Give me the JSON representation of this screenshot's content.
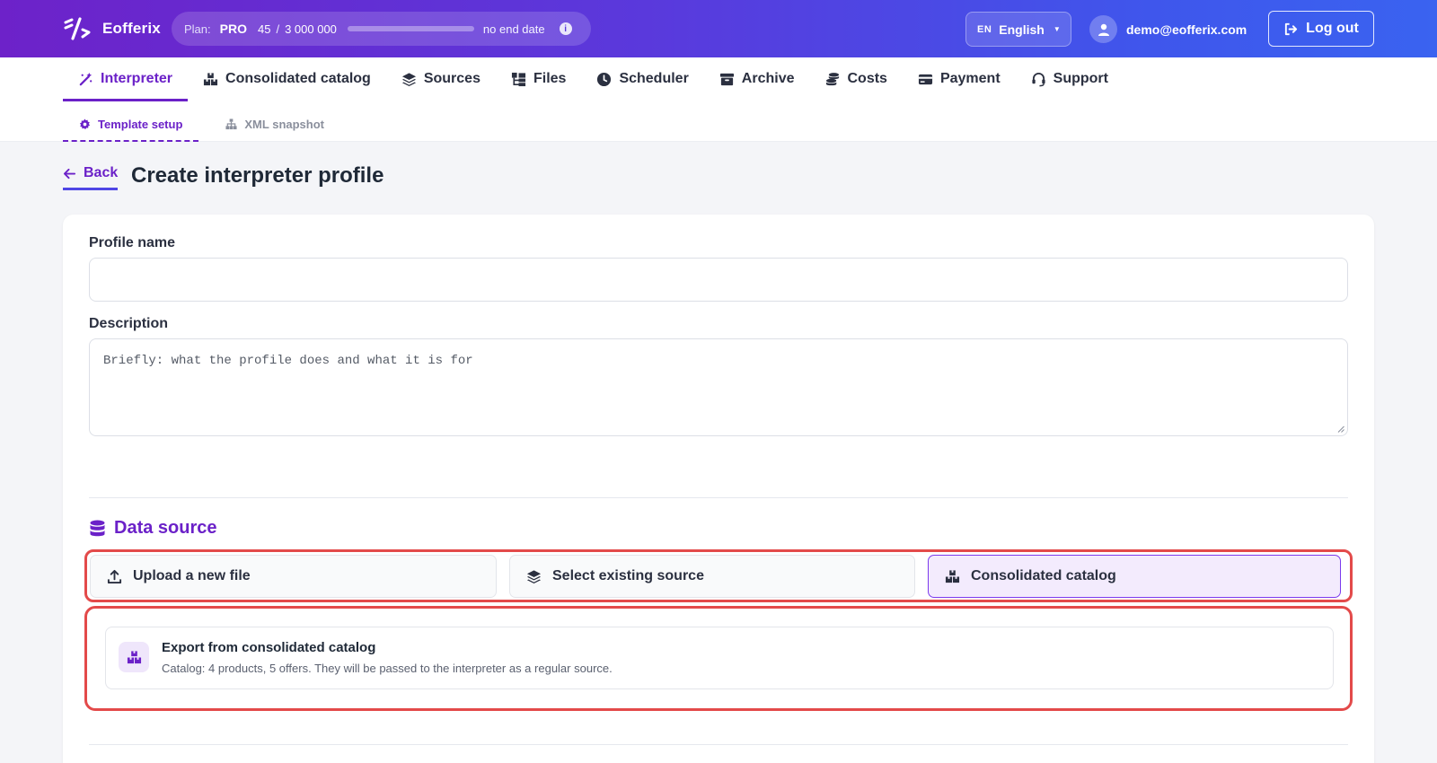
{
  "app": {
    "name": "Eofferix"
  },
  "plan": {
    "label": "Plan:",
    "tier": "PRO",
    "used": "45",
    "separator": "/",
    "limit": "3 000 000",
    "usage_fraction": 1.5e-05,
    "end_date": "no end date"
  },
  "language": {
    "code": "EN",
    "name": "English"
  },
  "user": {
    "email": "demo@eofferix.com"
  },
  "logout_label": "Log out",
  "nav": {
    "tabs": [
      {
        "label": "Interpreter",
        "icon": "magic-wand-icon",
        "active": true
      },
      {
        "label": "Consolidated catalog",
        "icon": "boxes-icon",
        "active": false
      },
      {
        "label": "Sources",
        "icon": "layers-icon",
        "active": false
      },
      {
        "label": "Files",
        "icon": "folder-tree-icon",
        "active": false
      },
      {
        "label": "Scheduler",
        "icon": "clock-icon",
        "active": false
      },
      {
        "label": "Archive",
        "icon": "archive-icon",
        "active": false
      },
      {
        "label": "Costs",
        "icon": "coins-icon",
        "active": false
      },
      {
        "label": "Payment",
        "icon": "credit-card-icon",
        "active": false
      },
      {
        "label": "Support",
        "icon": "headset-icon",
        "active": false
      }
    ],
    "subtabs": [
      {
        "label": "Template setup",
        "icon": "gear-icon",
        "active": true
      },
      {
        "label": "XML snapshot",
        "icon": "sitemap-icon",
        "active": false
      }
    ]
  },
  "page": {
    "back_label": "Back",
    "title": "Create interpreter profile"
  },
  "form": {
    "profile_name_label": "Profile name",
    "profile_name_value": "",
    "description_label": "Description",
    "description_placeholder": "Briefly: what the profile does and what it is for",
    "data_source_title": "Data source",
    "source_options": [
      {
        "label": "Upload a new file",
        "icon": "upload-icon",
        "active": false
      },
      {
        "label": "Select existing source",
        "icon": "layers-icon",
        "active": false
      },
      {
        "label": "Consolidated catalog",
        "icon": "boxes-icon",
        "active": true
      }
    ],
    "export": {
      "title": "Export from consolidated catalog",
      "description": "Catalog: 4 products, 5 offers. They will be passed to the interpreter as a regular source."
    }
  },
  "colors": {
    "accent": "#6b21c8",
    "highlight_border": "#e34a4a",
    "topbar_start": "#6d22c9",
    "topbar_end": "#3a63f0"
  }
}
